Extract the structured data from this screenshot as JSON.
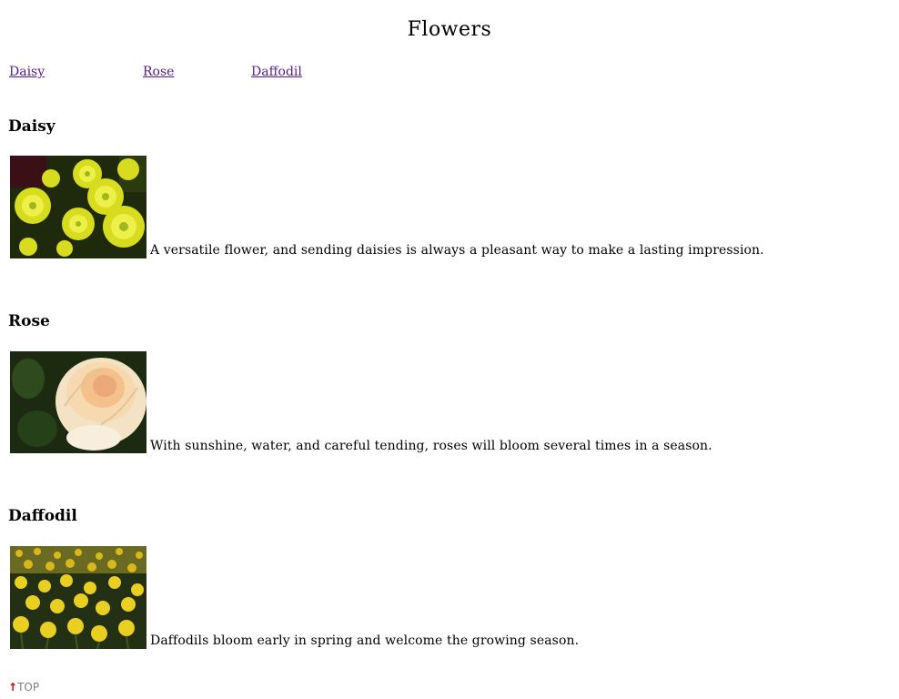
{
  "page": {
    "title": "Flowers"
  },
  "nav": {
    "links": [
      {
        "label": "Daisy"
      },
      {
        "label": "Rose"
      },
      {
        "label": "Daffodil"
      }
    ]
  },
  "sections": [
    {
      "heading": "Daisy",
      "image_name": "daisy-photo",
      "description": "A versatile flower, and sending daisies is always a pleasant way to make a lasting impression."
    },
    {
      "heading": "Rose",
      "image_name": "rose-photo",
      "description": "With sunshine, water, and careful tending, roses will bloom several times in a season."
    },
    {
      "heading": "Daffodil",
      "image_name": "daffodil-photo",
      "description": "Daffodils bloom early in spring and welcome the growing season."
    }
  ],
  "footer": {
    "top_icon": "up-arrow-icon",
    "top_label": "TOP",
    "top_arrow_color": "#cc0000"
  },
  "colors": {
    "link_visited": "#551a8b",
    "top_text": "#808080"
  }
}
